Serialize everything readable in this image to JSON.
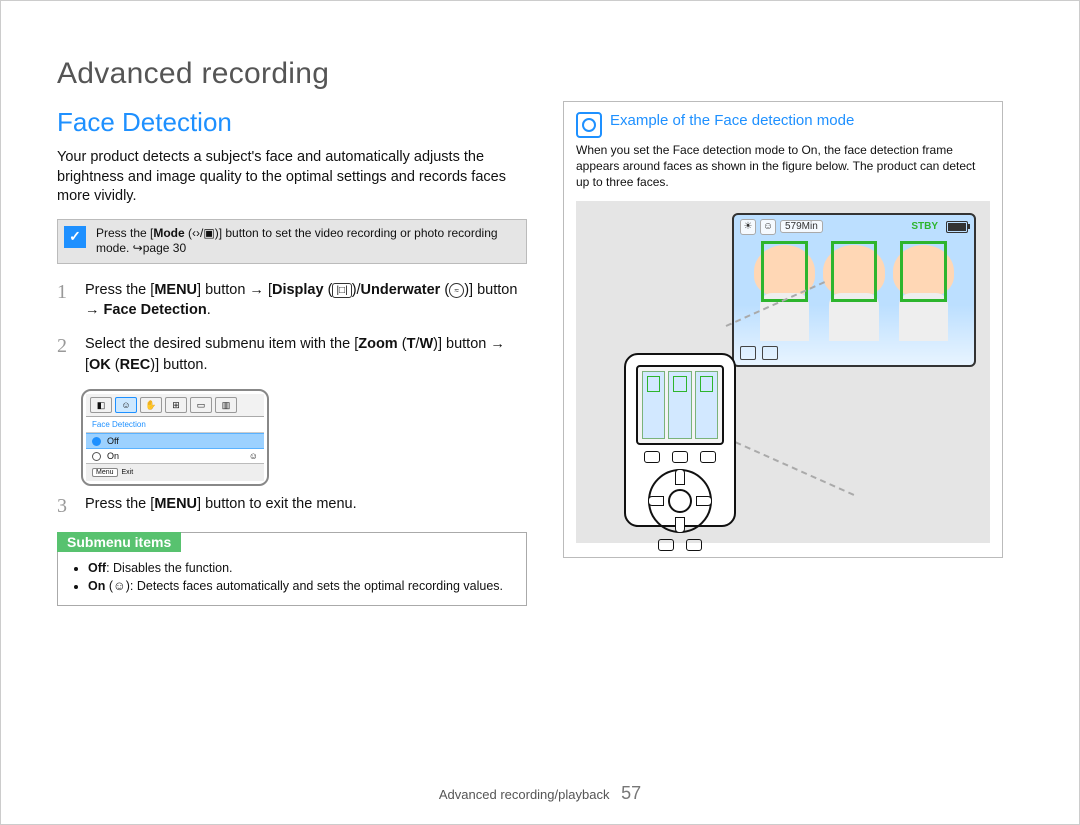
{
  "page_title": "Advanced recording",
  "section_title": "Face Detection",
  "intro": "Your product detects a subject's face and automatically adjusts the brightness and image quality to the optimal settings and records faces more vividly.",
  "note": {
    "text_parts": [
      "Press the [",
      "Mode",
      " (‹›/▣)] button to set the video recording or photo recording mode. ↪page 30"
    ]
  },
  "steps": [
    {
      "segments": [
        {
          "t": "Press the ["
        },
        {
          "t": "MENU",
          "b": true
        },
        {
          "t": "] button → ["
        },
        {
          "t": "Display",
          "b": true
        },
        {
          "t": " ("
        },
        {
          "icon": "display"
        },
        {
          "t": ")/"
        },
        {
          "t": "Underwater",
          "b": true
        },
        {
          "t": " ("
        },
        {
          "icon": "underwater"
        },
        {
          "t": ")] button → "
        },
        {
          "t": "Face Detection",
          "b": true
        },
        {
          "t": "."
        }
      ]
    },
    {
      "segments": [
        {
          "t": "Select the desired submenu item with the ["
        },
        {
          "t": "Zoom",
          "b": true
        },
        {
          "t": " ("
        },
        {
          "t": "T",
          "b": true
        },
        {
          "t": "/"
        },
        {
          "t": "W",
          "b": true
        },
        {
          "t": ")] button → ["
        },
        {
          "t": "OK",
          "b": true
        },
        {
          "t": " ("
        },
        {
          "t": "REC",
          "b": true
        },
        {
          "t": ")] button."
        }
      ],
      "has_menu_shot": true
    },
    {
      "segments": [
        {
          "t": "Press the ["
        },
        {
          "t": "MENU",
          "b": true
        },
        {
          "t": "] button to exit the menu."
        }
      ]
    }
  ],
  "menu_shot": {
    "header": "Face Detection",
    "rows": [
      {
        "label": "Off",
        "selected": true
      },
      {
        "label": "On",
        "selected": false,
        "icon": true
      }
    ],
    "footer_btn": "Menu",
    "footer_text": "Exit"
  },
  "submenu": {
    "title": "Submenu items",
    "items": [
      {
        "label": "Off",
        "desc": ": Disables the function."
      },
      {
        "label": "On",
        "icon": true,
        "desc": ": Detects faces automatically and sets the optimal recording values."
      }
    ]
  },
  "example": {
    "title": "Example of the Face detection mode",
    "text": "When you set the Face detection mode to On, the face detection frame appears around faces as shown in the figure below. The product can detect up to three faces.",
    "status": {
      "time": "579Min",
      "stby": "STBY"
    }
  },
  "footer": {
    "section": "Advanced recording/playback",
    "page": "57"
  }
}
